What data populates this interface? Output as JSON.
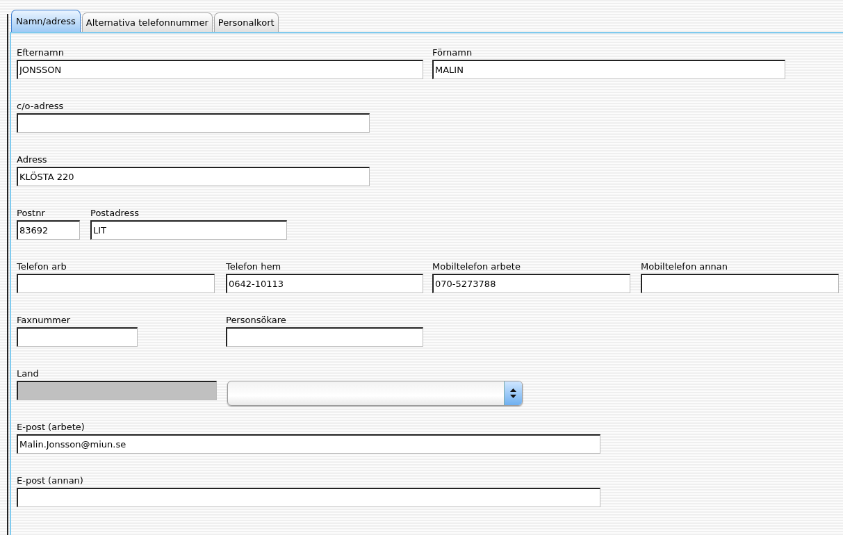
{
  "tabs": [
    {
      "label": "Namn/adress",
      "selected": true
    },
    {
      "label": "Alternativa telefonnummer",
      "selected": false
    },
    {
      "label": "Personalkort",
      "selected": false
    }
  ],
  "rows": [
    {
      "fields": [
        {
          "kind": "text",
          "label": "Efternamn",
          "value": "JONSSON"
        },
        {
          "kind": "text",
          "label": "Förnamn",
          "value": "MALIN"
        }
      ]
    },
    {
      "fields": [
        {
          "kind": "text",
          "label": "c/o-adress"
        }
      ]
    },
    {
      "fields": [
        {
          "kind": "text",
          "label": "Adress",
          "value": "KLÖSTA 220"
        }
      ]
    },
    {
      "fields": [
        {
          "kind": "text",
          "label": "Postnr",
          "value": "83692"
        },
        {
          "kind": "text",
          "label": "Postadress",
          "value": "LIT"
        }
      ]
    },
    {
      "fields": [
        {
          "kind": "text",
          "label": "Telefon arb"
        },
        {
          "kind": "text",
          "label": "Telefon hem",
          "value": "0642-10113"
        },
        {
          "kind": "text",
          "label": "Mobiltelefon arbete",
          "value": "070-5273788"
        },
        {
          "kind": "text",
          "label": "Mobiltelefon annan"
        }
      ]
    },
    {
      "fields": [
        {
          "kind": "text",
          "label": "Faxnummer"
        },
        {
          "kind": "text",
          "label": "Personsökare"
        }
      ]
    },
    {
      "fields": [
        {
          "kind": "disabled",
          "label": "Land"
        },
        {
          "kind": "select"
        }
      ]
    },
    {
      "fields": [
        {
          "kind": "text",
          "label": "E-post (arbete)",
          "value": "Malin.Jonsson@miun.se"
        }
      ]
    },
    {
      "fields": [
        {
          "kind": "text",
          "label": "E-post (annan)"
        }
      ]
    }
  ]
}
